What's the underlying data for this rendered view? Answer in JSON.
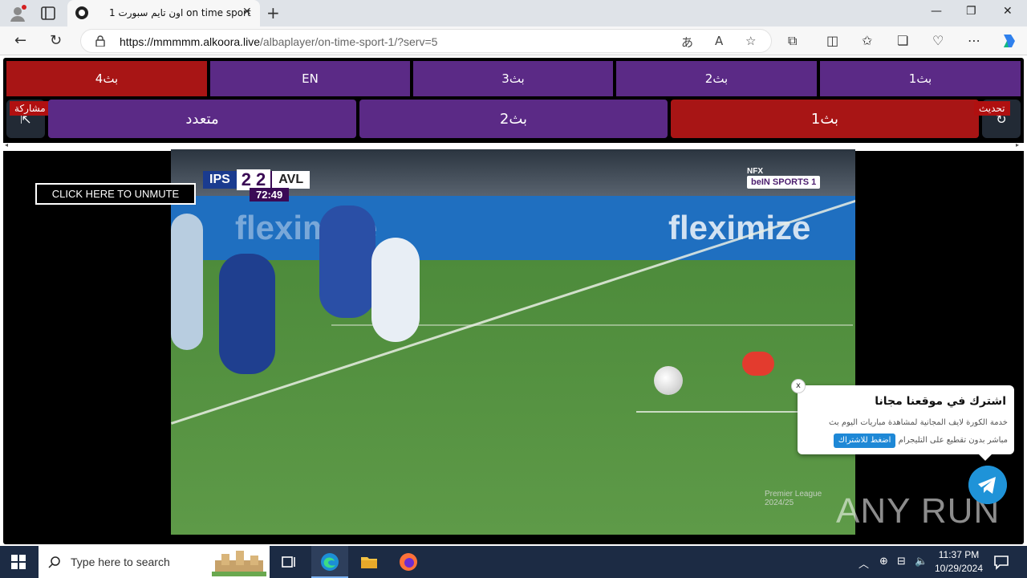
{
  "browser": {
    "tab_title": "اون تايم سبورت 1 on time sport",
    "url_host": "https://mmmmm.alkoora.live",
    "url_path": "/albaplayer/on-time-sport-1/?serv=5"
  },
  "servers": [
    {
      "label": "بث4",
      "active": true
    },
    {
      "label": "EN",
      "active": false
    },
    {
      "label": "بث3",
      "active": false
    },
    {
      "label": "بث2",
      "active": false
    },
    {
      "label": "بث1",
      "active": false
    }
  ],
  "main_buttons": [
    {
      "label": "متعدد",
      "active": false
    },
    {
      "label": "بث2",
      "active": false
    },
    {
      "label": "بث1",
      "active": true
    }
  ],
  "share_label": "مشاركة",
  "refresh_label": "تحديث",
  "video": {
    "home_team": "IPS",
    "home_score": "2",
    "away_score": "2",
    "away_team": "AVL",
    "match_time": "72:49",
    "channel_prefix": "NFX",
    "channel": "beIN SPORTS 1",
    "league_watermark": "Premier League",
    "season": "2024/25",
    "ad_text": "fleximize"
  },
  "unmute_label": "CLICK HERE TO UNMUTE",
  "popup": {
    "title": "اشترك في موقعنا مجانا",
    "desc1": "خدمة الكورة لايف المجانية لمشاهدة مباريات اليوم بث",
    "desc2": "مباشر بدون تقطيع على التليجرام",
    "button": "اضغط للاشتراك",
    "close": "x"
  },
  "watermark": "ANY RUN",
  "taskbar": {
    "search_placeholder": "Type here to search",
    "time": "11:37 PM",
    "date": "10/29/2024"
  },
  "colors": {
    "purple": "#5b2a86",
    "red": "#a81515",
    "telegram": "#1f93d8"
  }
}
